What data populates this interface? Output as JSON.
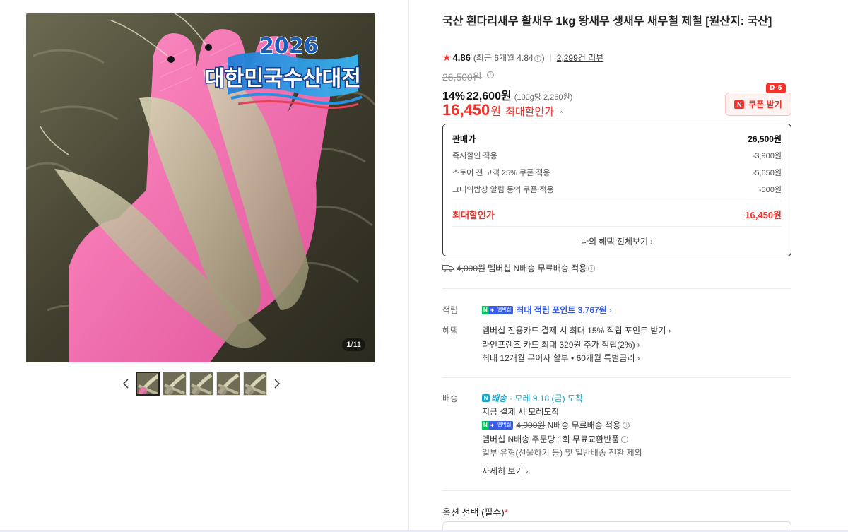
{
  "gallery": {
    "badge_year": "2026",
    "badge_title": "대한민국수산대전",
    "counter_current": "1",
    "counter_total": "/11",
    "thumb_count": 5,
    "active_thumb": 0
  },
  "product": {
    "title": "국산 흰다리새우 활새우 1kg 왕새우 생새우 새우철 제철 [원산지: 국산]",
    "rating": "4.86",
    "recent_rating": "(최근 6개월 4.84",
    "recent_rating_close": ")",
    "review_count": "2,299건 리뷰",
    "original_price": "26,500원",
    "discount_rate": "14%",
    "sale_price": "22,600원",
    "unit_price": "(100g당 2,260원)",
    "max_price": "16,450",
    "max_won": "원",
    "max_label": "최대할인가"
  },
  "coupon": {
    "badge": "D-6",
    "label": "쿠폰 받기",
    "logo": "N"
  },
  "price_breakdown": {
    "rows": [
      {
        "label": "판매가",
        "value": "26,500원"
      },
      {
        "label": "즉시할인 적용",
        "value": "-3,900원"
      },
      {
        "label": "스토어 전 고객 25% 쿠폰 적용",
        "value": "-5,650원"
      },
      {
        "label": "그대의밥상 알림 동의 쿠폰 적용",
        "value": "-500원"
      }
    ],
    "total_label": "최대할인가",
    "total_value": "16,450원",
    "more_label": "나의 혜택 전체보기"
  },
  "shipping_summary": {
    "fee": "4,000원",
    "text": "멤버십 N배송 무료배송 적용"
  },
  "benefits": {
    "points_label": "적립",
    "points_text": "최대 적립 포인트 3,767원",
    "perks_label": "혜택",
    "perks": [
      "멤버십 전용카드 결제 시 최대 15% 적립 포인트 받기",
      "라인프렌즈 카드 최대 329원 추가 적립(2%)",
      "최대 12개월 무이자 할부 • 60개월 특별금리"
    ]
  },
  "delivery": {
    "label": "배송",
    "logo_text": "배송",
    "eta": "· 모레 9.18.(금) 도착",
    "line1": "지금 결제 시 모레도착",
    "fee": "4,000원",
    "fee_text": "N배송 무료배송 적용",
    "line3": "멤버십 N배송 주문당 1회 무료교환반품",
    "line4": "일부 유형(선물하기 등) 및 일반배송 전환 제외",
    "more": "자세히 보기"
  },
  "options": {
    "label": "옵션 선택 (필수)",
    "required_mark": "*"
  },
  "membership_badge": {
    "n": "N",
    "plus": "+",
    "text": "멤버십"
  },
  "colors": {
    "accent_red": "#f5312b",
    "membership_blue": "#3a5de8",
    "delivery_teal": "#1aa7c9"
  }
}
